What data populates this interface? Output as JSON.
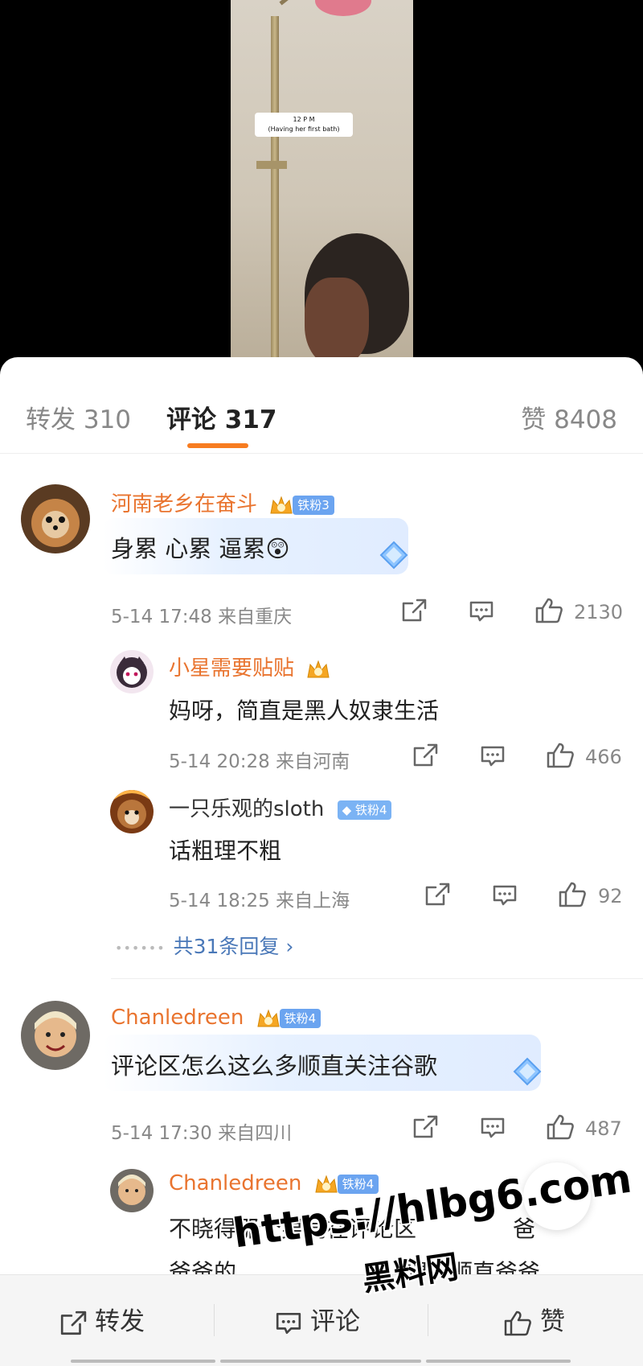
{
  "video": {
    "caption_line1": "12 P M",
    "caption_line2": "(Having her first bath)"
  },
  "tabs": {
    "repost": "转发 310",
    "comments": "评论 317",
    "likes": "赞 8408"
  },
  "comments": [
    {
      "username": "河南老乡在奋斗",
      "fan_badge": "铁粉3",
      "text": "身累 心累 逼累😲",
      "time_location": "5-14 17:48 来自重庆",
      "likes": "2130",
      "replies": [
        {
          "username": "小星需要贴贴",
          "text": "妈呀，简直是黑人奴隶生活",
          "time_location": "5-14 20:28 来自河南",
          "likes": "466"
        },
        {
          "username": "一只乐观的sloth",
          "fan_badge": "铁粉4",
          "text": "话粗理不粗",
          "time_location": "5-14 18:25 来自上海",
          "likes": "92"
        }
      ],
      "more_replies": "共31条回复 ›"
    },
    {
      "username": "Chanledreen",
      "fan_badge": "铁粉4",
      "text": "评论区怎么这么多顺直关注谷歌",
      "time_location": "5-14 17:30 来自四川",
      "likes": "487",
      "replies": [
        {
          "username": "Chanledreen",
          "fan_badge": "铁粉4",
          "text_line1": "不晓得那个男同在评论区",
          "text_line1_tail": "爸",
          "text_line2_head": "爸爸的",
          "text_line2_tail": "想要顺直爸爸"
        }
      ]
    }
  ],
  "bottom_bar": {
    "repost": "转发",
    "comment": "评论",
    "like": "赞"
  },
  "watermark": {
    "url": "https://hlbg6.com",
    "cn": "黑料网"
  },
  "colors": {
    "accent": "#f77c20",
    "username": "#e9742f",
    "link": "#4a78b8"
  }
}
